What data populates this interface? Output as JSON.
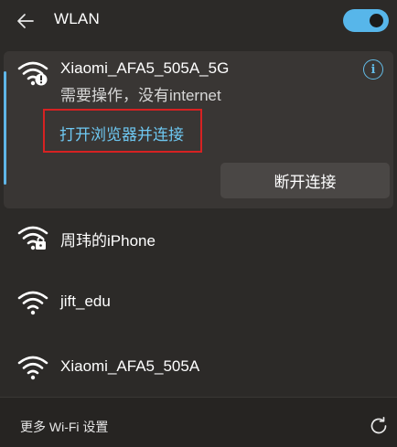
{
  "header": {
    "title": "WLAN",
    "back_icon": "arrow-left-icon",
    "toggle_state": "on"
  },
  "active_network": {
    "ssid": "Xiaomi_AFA5_505A_5G",
    "status": "需要操作，没有internet",
    "icon": "wifi-warning-icon",
    "info_icon_glyph": "i",
    "open_browser_label": "打开浏览器并连接",
    "disconnect_label": "断开连接"
  },
  "networks": [
    {
      "ssid": "周玮的iPhone",
      "icon": "wifi-locked-icon"
    },
    {
      "ssid": "jift_edu",
      "icon": "wifi-icon"
    },
    {
      "ssid": "Xiaomi_AFA5_505A",
      "icon": "wifi-icon"
    }
  ],
  "footer": {
    "more_settings_label": "更多 Wi-Fi 设置",
    "refresh_icon": "refresh-icon"
  },
  "colors": {
    "accent": "#57b6ea",
    "link": "#6ec8f2",
    "highlight_box": "#d62222",
    "background": "#2c2a28"
  }
}
